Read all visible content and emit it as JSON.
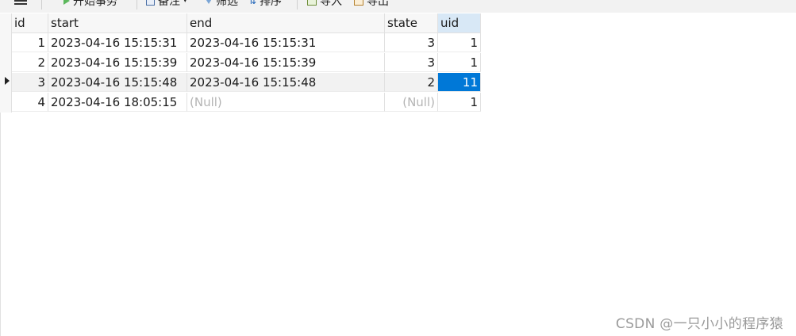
{
  "toolbar": {
    "items": [
      {
        "label": "开始事务",
        "icon": "play-icon"
      },
      {
        "label": "备注",
        "icon": "memo-icon"
      },
      {
        "label": "筛选",
        "icon": "filter-icon"
      },
      {
        "label": "排序",
        "icon": "sort-icon"
      },
      {
        "label": "导入",
        "icon": "import-icon"
      },
      {
        "label": "导出",
        "icon": "export-icon"
      }
    ]
  },
  "table": {
    "columns": [
      "id",
      "start",
      "end",
      "state",
      "uid"
    ],
    "rows": [
      {
        "id": "1",
        "start": "2023-04-16 15:15:31",
        "end": "2023-04-16 15:15:31",
        "state": "3",
        "uid": "1"
      },
      {
        "id": "2",
        "start": "2023-04-16 15:15:39",
        "end": "2023-04-16 15:15:39",
        "state": "3",
        "uid": "1"
      },
      {
        "id": "3",
        "start": "2023-04-16 15:15:48",
        "end": "2023-04-16 15:15:48",
        "state": "2",
        "uid": "11"
      },
      {
        "id": "4",
        "start": "2023-04-16 18:05:15",
        "end": "(Null)",
        "state": "(Null)",
        "uid": "1"
      }
    ],
    "active_row": 3,
    "active_column": "uid"
  },
  "watermark": "CSDN @一只小小的程序猿",
  "colors": {
    "selection": "#0078d7",
    "header_active": "#d8e8f6",
    "null_text": "#b4b4b4"
  }
}
